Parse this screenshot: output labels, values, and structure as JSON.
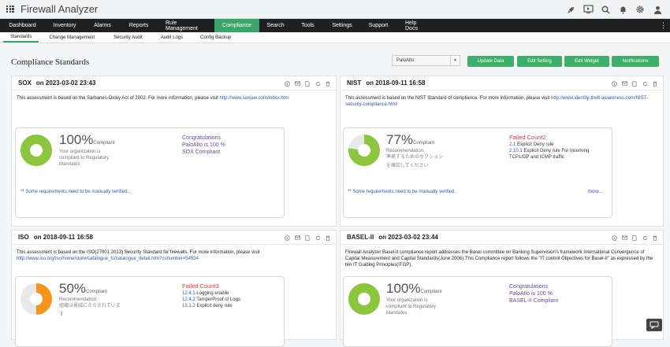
{
  "app": {
    "title": "Firewall Analyzer"
  },
  "topbar_icons": [
    "rocket-icon",
    "monitor-icon",
    "search-icon",
    "bell-icon",
    "gear-icon",
    "user-icon"
  ],
  "nav": [
    "Dashboard",
    "Inventory",
    "Alarms",
    "Reports",
    "Rule Management",
    "Compliance",
    "Search",
    "Tools",
    "Settings",
    "Support",
    "Help Docs"
  ],
  "nav_active": "Compliance",
  "subnav": [
    "Standards",
    "Change Management",
    "Security Audit",
    "Audit Logs",
    "Config Backup"
  ],
  "subnav_active": "Standards",
  "page": {
    "title": "Compliance Standards",
    "device": "PaloAlto",
    "buttons": [
      "Update Data",
      "Edit Setting",
      "Edit Widget",
      "Notifications"
    ]
  },
  "panels": {
    "sox": {
      "name": "SOX",
      "date": "on 2023-03-02 23:43",
      "desc": "This assessment is based on the Sarbanes-Oxley Act of 2002. For more information, please visit",
      "link": "http://www.soxlaw.com/index.htm",
      "pct": "100%",
      "pct_label": "Compliant",
      "sub": [
        "Your organization is",
        "compliant to Regulatory",
        "Mandates"
      ],
      "congrats": [
        "Congratulations",
        "PaloAlto is 100 %",
        "SOX Compliant"
      ],
      "note": "** Some requirements need to be manually verified.:",
      "value": 1.0
    },
    "nist": {
      "name": "NIST",
      "date": "on 2018-09-11 16:58",
      "desc": "This assessment is based on the NIST Standard of compliance. For more information, please visit",
      "link": "http://www.identity-theft-awareness.com/NIST-security-compliance.html",
      "pct": "77%",
      "pct_label": "Compliant",
      "rec_label": "Recommendation:",
      "rec_text": [
        "準拠するためのセクション",
        "を確認してください"
      ],
      "failed": "Failed Count2",
      "fail_rows": [
        {
          "id": "2.1",
          "text": "Explicit Deny rule"
        },
        {
          "id": "2.10.1",
          "text": "Explicit Deny rule For Incoming"
        },
        {
          "id": "",
          "text": "TCP,UDP and ICMP traffic"
        }
      ],
      "note": "** Some requirements need to be manually verified.:",
      "more": "more...",
      "value": 0.77
    },
    "iso": {
      "name": "ISO",
      "date": "on 2018-09-11 16:58",
      "desc": "This assessment is based on the ISO(27001:2013) Security Standard for firewalls. For more information, please visit",
      "link": "http://www.iso.org/iso/home/store/catalogue_tc/catalogue_detail.htm?csnumber=54534",
      "pct": "50%",
      "pct_label": "Compliant",
      "rec_label": "Recommendation:",
      "rec_text": [
        "組織は脅威にさらされていま",
        "す"
      ],
      "failed": "Failed Count3",
      "fail_rows": [
        {
          "id": "12.4.1",
          "text": "Logging enable"
        },
        {
          "id": "12.4.2",
          "text": "TamperProof of Logs"
        },
        {
          "id": "13.1.2",
          "text": "Explicit deny rule"
        }
      ],
      "value": 0.5
    },
    "basel": {
      "name": "BASEL-II",
      "date": "on 2023-03-02 23:44",
      "desc": "Firewall Analyzer Basel-II compliance report addresses the Basel committee on Banking Supervision's framework International Convergence of Capital Measurement and Capital Standards(June 2006).This Compliance report follows the \"IT control Objectives for Basel-II\" as expressed by the ten IT Guiding Principles(ITGP).",
      "pct": "100%",
      "pct_label": "Compliant",
      "sub": [
        "Your organization is",
        "compliant to Regulatory",
        "Mandates"
      ],
      "congrats": [
        "Congratulations",
        "PaloAlto is 100 %",
        "BASEL-II Compliant"
      ],
      "value": 1.0
    }
  },
  "colors": {
    "green": "#8cc63f",
    "orange": "#f7941d",
    "accent": "#3da36a"
  }
}
